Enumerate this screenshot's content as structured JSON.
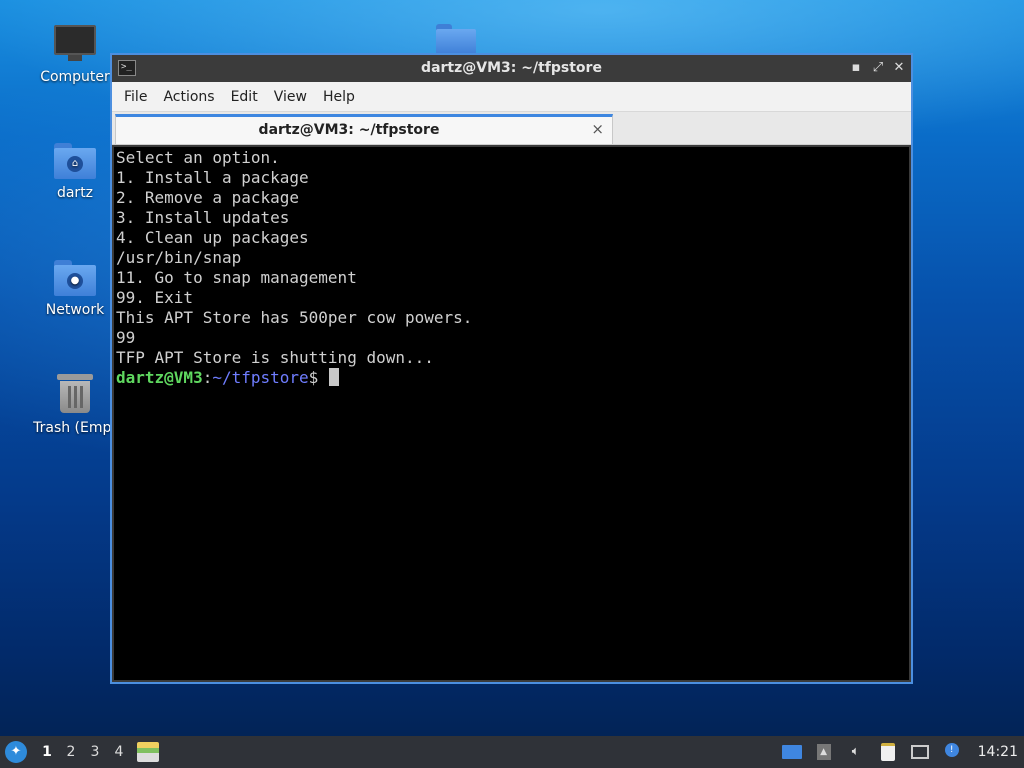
{
  "desktop": {
    "icons": [
      {
        "label": "Computer"
      },
      {
        "label": "dartz"
      },
      {
        "label": "Network"
      },
      {
        "label": "Trash (Empt"
      }
    ]
  },
  "window": {
    "title": "dartz@VM3: ~/tfpstore",
    "controls": {
      "minimize": "▪",
      "maximize": "⤢",
      "close": "✕"
    },
    "menu": [
      "File",
      "Actions",
      "Edit",
      "View",
      "Help"
    ],
    "tab": {
      "title": "dartz@VM3: ~/tfpstore",
      "close": "×"
    }
  },
  "terminal": {
    "lines": [
      "Select an option.",
      "1. Install a package",
      "2. Remove a package",
      "3. Install updates",
      "4. Clean up packages",
      "/usr/bin/snap",
      "11. Go to snap management",
      "99. Exit",
      "This APT Store has 500per cow powers.",
      "99",
      "TFP APT Store is shutting down..."
    ],
    "prompt": {
      "user": "dartz@VM3",
      "sep": ":",
      "path": "~/tfpstore",
      "symbol": "$ "
    },
    "colors": {
      "user": "#5fd75f",
      "path": "#6f7dff",
      "text": "#d0d0d0",
      "background": "#000000"
    }
  },
  "taskbar": {
    "workspaces": [
      "1",
      "2",
      "3",
      "4"
    ],
    "active_workspace": "1",
    "clock": "14:21",
    "tray_icons": [
      "window-icon",
      "tray-up-icon",
      "volume-icon",
      "clipboard-icon",
      "network-icon",
      "updates-icon"
    ]
  }
}
